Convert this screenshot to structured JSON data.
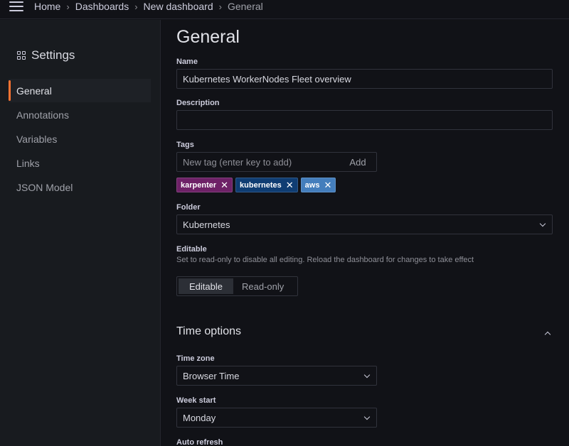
{
  "breadcrumbs": [
    "Home",
    "Dashboards",
    "New dashboard",
    "General"
  ],
  "sidebar": {
    "title": "Settings",
    "items": [
      {
        "label": "General",
        "active": true
      },
      {
        "label": "Annotations"
      },
      {
        "label": "Variables"
      },
      {
        "label": "Links"
      },
      {
        "label": "JSON Model"
      }
    ]
  },
  "main": {
    "title": "General",
    "name": {
      "label": "Name",
      "value": "Kubernetes WorkerNodes Fleet overview"
    },
    "description": {
      "label": "Description",
      "value": ""
    },
    "tags": {
      "label": "Tags",
      "placeholder": "New tag (enter key to add)",
      "add_label": "Add",
      "items": [
        {
          "label": "karpenter",
          "color": "#6e2167"
        },
        {
          "label": "kubernetes",
          "color": "#0f3d73"
        },
        {
          "label": "aws",
          "color": "#447ebc"
        }
      ]
    },
    "folder": {
      "label": "Folder",
      "value": "Kubernetes"
    },
    "editable": {
      "label": "Editable",
      "description": "Set to read-only to disable all editing. Reload the dashboard for changes to take effect",
      "options": [
        "Editable",
        "Read-only"
      ],
      "selected": "Editable"
    },
    "time_options": {
      "title": "Time options",
      "timezone": {
        "label": "Time zone",
        "value": "Browser Time"
      },
      "week_start": {
        "label": "Week start",
        "value": "Monday"
      },
      "auto_refresh": {
        "label": "Auto refresh"
      }
    }
  },
  "colors": {
    "accent": "#ff7432",
    "background": "#111217",
    "panel": "#181b1f"
  }
}
